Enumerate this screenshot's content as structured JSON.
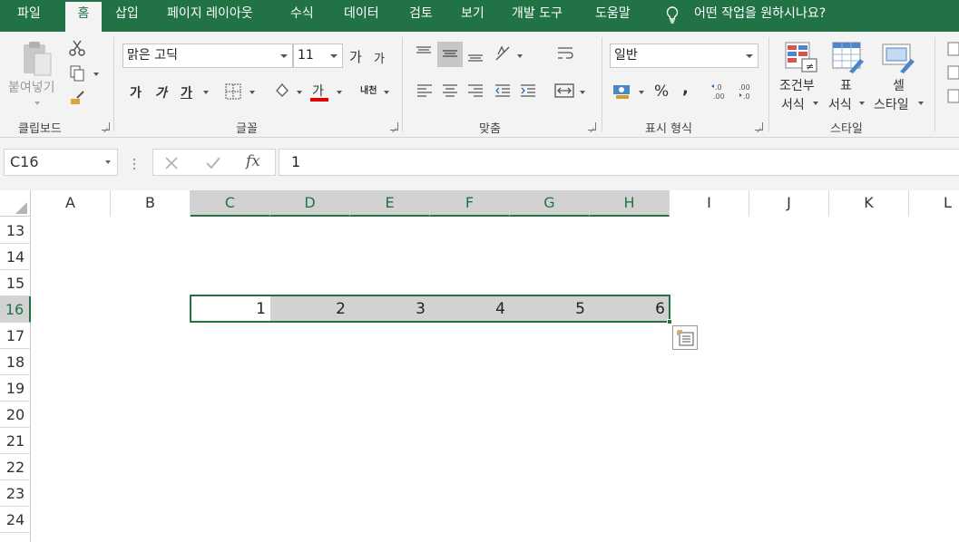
{
  "tabs": [
    {
      "label": "파일",
      "name": "tab-file"
    },
    {
      "label": "홈",
      "name": "tab-home"
    },
    {
      "label": "삽입",
      "name": "tab-insert"
    },
    {
      "label": "페이지 레이아웃",
      "name": "tab-page-layout"
    },
    {
      "label": "수식",
      "name": "tab-formulas"
    },
    {
      "label": "데이터",
      "name": "tab-data"
    },
    {
      "label": "검토",
      "name": "tab-review"
    },
    {
      "label": "보기",
      "name": "tab-view"
    },
    {
      "label": "개발 도구",
      "name": "tab-developer"
    },
    {
      "label": "도움말",
      "name": "tab-help"
    }
  ],
  "tell_me": "어떤 작업을 원하시나요?",
  "ribbon": {
    "clipboard": {
      "label": "클립보드",
      "paste": "붙여넣기"
    },
    "font": {
      "label": "글꼴",
      "font_name": "맑은 고딕",
      "font_size": "11",
      "grow": "가",
      "shrink": "가",
      "bold": "가",
      "italic": "가",
      "underline": "가",
      "font_color_sample": "가",
      "phonetic": "내천"
    },
    "alignment": {
      "label": "맞춤"
    },
    "number": {
      "label": "표시 형식",
      "format": "일반",
      "percent": "%",
      "comma": ","
    },
    "styles": {
      "label": "스타일",
      "conditional_line1": "조건부",
      "conditional_line2": "서식",
      "table_line1": "표",
      "table_line2": "서식",
      "cell_line1": "셀",
      "cell_line2": "스타일"
    }
  },
  "formula_bar": {
    "name_box": "C16",
    "fx": "fx",
    "formula": "1"
  },
  "columns": [
    "A",
    "B",
    "C",
    "D",
    "E",
    "F",
    "G",
    "H",
    "I",
    "J",
    "K",
    "L"
  ],
  "rows": [
    "13",
    "14",
    "15",
    "16",
    "17",
    "18",
    "19",
    "20",
    "21",
    "22",
    "23",
    "24"
  ],
  "cells": [
    {
      "ref": "C16",
      "value": "1"
    },
    {
      "ref": "D16",
      "value": "2"
    },
    {
      "ref": "E16",
      "value": "3"
    },
    {
      "ref": "F16",
      "value": "4"
    },
    {
      "ref": "G16",
      "value": "5"
    },
    {
      "ref": "H16",
      "value": "6"
    }
  ],
  "colors": {
    "accent": "#217346",
    "selection": "#d2d2d2",
    "font_red": "#e00000"
  }
}
